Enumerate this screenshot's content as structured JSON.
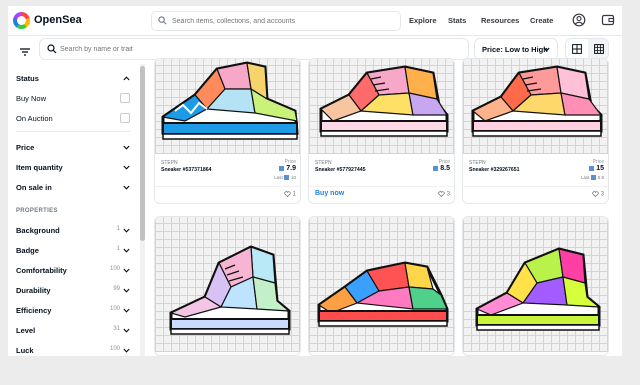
{
  "header": {
    "brand": "OpenSea",
    "search_placeholder": "Search items, collections, and accounts",
    "nav": [
      "Explore",
      "Stats",
      "Resources",
      "Create"
    ]
  },
  "toolbar": {
    "search_placeholder": "Search by name or trait",
    "sort_label": "Price: Low to High"
  },
  "sidebar": {
    "status_label": "Status",
    "buy_now": "Buy Now",
    "on_auction": "On Auction",
    "price": "Price",
    "item_quantity": "Item quantity",
    "on_sale_in": "On sale in",
    "properties_heading": "PROPERTIES",
    "properties": [
      {
        "label": "Background",
        "count": "1"
      },
      {
        "label": "Badge",
        "count": "1"
      },
      {
        "label": "Comfortability",
        "count": "100"
      },
      {
        "label": "Durability",
        "count": "99"
      },
      {
        "label": "Efficiency",
        "count": "100"
      },
      {
        "label": "Level",
        "count": "31"
      },
      {
        "label": "Luck",
        "count": "100"
      }
    ]
  },
  "cards": [
    {
      "collection": "STEPN",
      "name": "Sneaker #537371864",
      "price_label": "Price",
      "price": "7.9",
      "last_label": "Last",
      "last": "10",
      "favorites": "1",
      "buy_now": ""
    },
    {
      "collection": "STEPN",
      "name": "Sneaker #577927445",
      "price_label": "Price",
      "price": "8.5",
      "last_label": "",
      "last": "",
      "favorites": "3",
      "buy_now": "Buy now"
    },
    {
      "collection": "STEPN",
      "name": "Sneaker #329267651",
      "price_label": "Price",
      "price": "15",
      "last_label": "Last",
      "last": "5.8",
      "favorites": "3",
      "buy_now": ""
    },
    {
      "collection": "",
      "name": "",
      "price": "",
      "favorites": ""
    },
    {
      "collection": "",
      "name": "",
      "price": "",
      "favorites": ""
    },
    {
      "collection": "",
      "name": "",
      "price": "",
      "favorites": ""
    }
  ],
  "colors": {
    "accent": "#2081e2",
    "text": "#04111d",
    "muted": "#707a83",
    "border": "#e5e8eb"
  }
}
